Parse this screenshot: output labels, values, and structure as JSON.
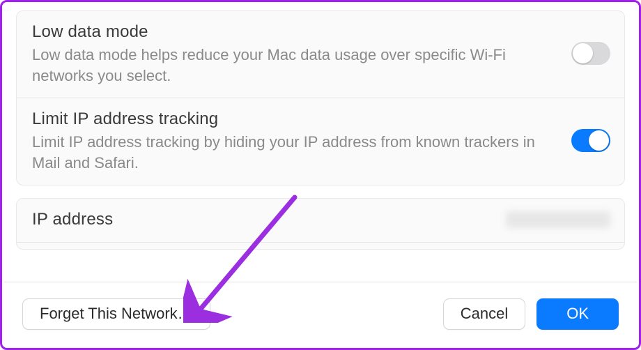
{
  "settings": {
    "low_data": {
      "title": "Low data mode",
      "desc": "Low data mode helps reduce your Mac data usage over specific Wi-Fi networks you select.",
      "enabled": false
    },
    "limit_ip": {
      "title": "Limit IP address tracking",
      "desc": "Limit IP address tracking by hiding your IP address from known trackers in Mail and Safari.",
      "enabled": true
    },
    "ip_address": {
      "title": "IP address"
    }
  },
  "buttons": {
    "forget": "Forget This Network…",
    "cancel": "Cancel",
    "ok": "OK"
  },
  "colors": {
    "accent": "#0a7bff",
    "annotation": "#9b2fe0"
  }
}
